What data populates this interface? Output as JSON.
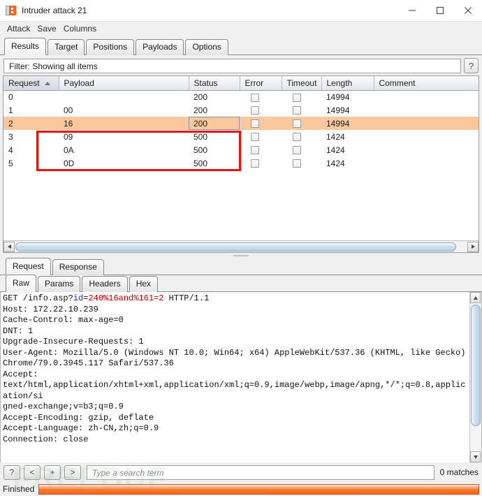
{
  "window": {
    "title": "Intruder attack 21",
    "icon": "burp-intruder-icon",
    "minimize": "–",
    "maximize": "□",
    "close": "✕"
  },
  "menubar": {
    "items": [
      {
        "label": "Attack"
      },
      {
        "label": "Save"
      },
      {
        "label": "Columns"
      }
    ]
  },
  "main_tabs": {
    "active": "Results",
    "items": [
      {
        "label": "Results"
      },
      {
        "label": "Target"
      },
      {
        "label": "Positions"
      },
      {
        "label": "Payloads"
      },
      {
        "label": "Options"
      }
    ]
  },
  "filter": {
    "text": "Filter: Showing all items",
    "help_label": "?"
  },
  "results_table": {
    "columns": [
      {
        "label": "Request",
        "sorted": true,
        "sort_dir": "asc"
      },
      {
        "label": "Payload"
      },
      {
        "label": "Status"
      },
      {
        "label": "Error"
      },
      {
        "label": "Timeout"
      },
      {
        "label": "Length"
      },
      {
        "label": "Comment"
      }
    ],
    "rows": [
      {
        "request": "0",
        "payload": "",
        "status": "200",
        "error": false,
        "timeout": false,
        "length": "14994",
        "comment": "",
        "selected": false
      },
      {
        "request": "1",
        "payload": "00",
        "status": "200",
        "error": false,
        "timeout": false,
        "length": "14994",
        "comment": "",
        "selected": false
      },
      {
        "request": "2",
        "payload": "16",
        "status": "200",
        "error": false,
        "timeout": false,
        "length": "14994",
        "comment": "",
        "selected": true
      },
      {
        "request": "3",
        "payload": "09",
        "status": "500",
        "error": false,
        "timeout": false,
        "length": "1424",
        "comment": "",
        "selected": false
      },
      {
        "request": "4",
        "payload": "0A",
        "status": "500",
        "error": false,
        "timeout": false,
        "length": "1424",
        "comment": "",
        "selected": false
      },
      {
        "request": "5",
        "payload": "0D",
        "status": "500",
        "error": false,
        "timeout": false,
        "length": "1424",
        "comment": "",
        "selected": false
      }
    ],
    "annotation_color": "#e8140b",
    "selected_row_color": "#fac89c"
  },
  "message_tabs": {
    "active": "Request",
    "items": [
      {
        "label": "Request"
      },
      {
        "label": "Response"
      }
    ]
  },
  "view_tabs": {
    "active": "Raw",
    "items": [
      {
        "label": "Raw"
      },
      {
        "label": "Params"
      },
      {
        "label": "Headers"
      },
      {
        "label": "Hex"
      }
    ]
  },
  "raw_request": {
    "line1_prefix": "GET /info.asp?",
    "line1_param": "id",
    "line1_eq": "=",
    "line1_value": "240%16and%161=2",
    "line1_suffix": " HTTP/1.1",
    "rest": "Host: 172.22.10.239\nCache-Control: max-age=0\nDNT: 1\nUpgrade-Insecure-Requests: 1\nUser-Agent: Mozilla/5.0 (Windows NT 10.0; Win64; x64) AppleWebKit/537.36 (KHTML, like Gecko)\nChrome/79.0.3945.117 Safari/537.36\nAccept:\ntext/html,application/xhtml+xml,application/xml;q=0.9,image/webp,image/apng,*/*;q=0.8,application/si\ngned-exchange;v=b3;q=0.9\nAccept-Encoding: gzip, deflate\nAccept-Language: zh-CN,zh;q=0.9\nConnection: close",
    "param_color": "#1133dd",
    "value_color": "#cc0000"
  },
  "search_bar": {
    "help_label": "?",
    "prev_label": "<",
    "add_label": "+",
    "next_label": ">",
    "placeholder": "Type a search term",
    "value": "",
    "matches": "0 matches"
  },
  "status_bar": {
    "text": "Finished",
    "progress_percent": 100,
    "progress_color": "#f4671a"
  },
  "watermark": {
    "text": "FREEBUF"
  }
}
